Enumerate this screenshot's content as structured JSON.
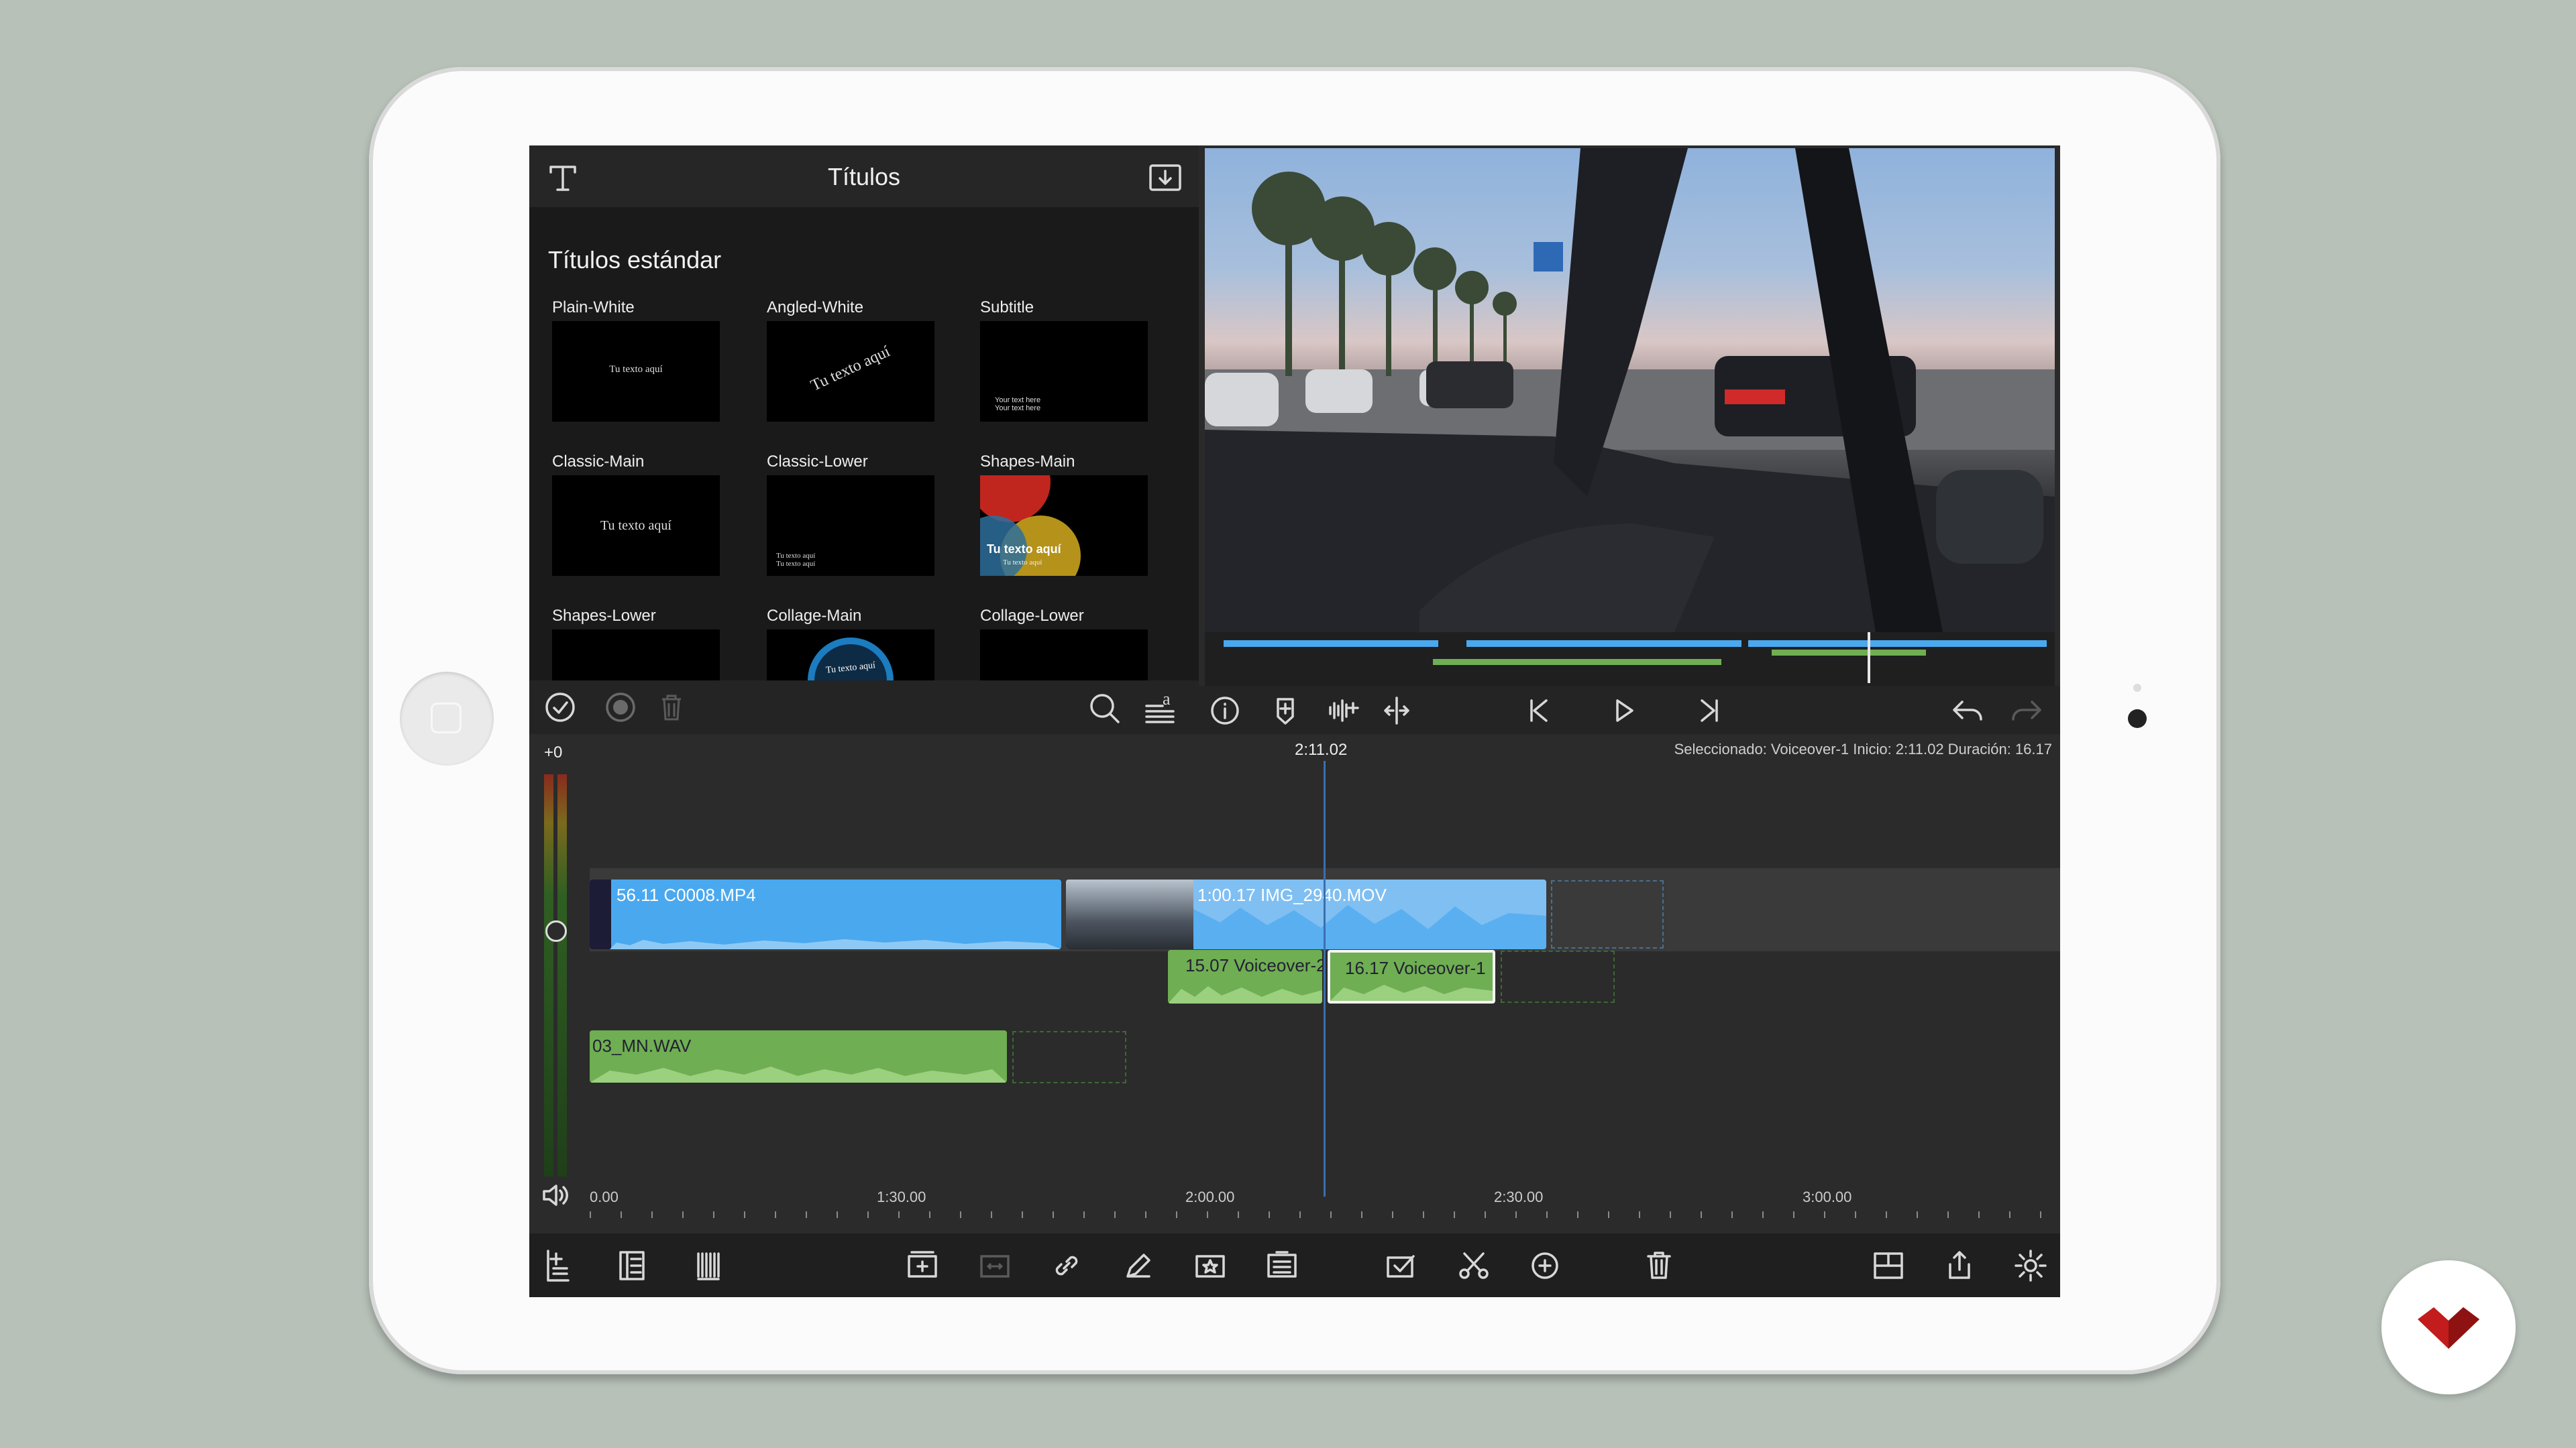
{
  "titles_panel": {
    "title": "Títulos",
    "section": "Títulos estándar",
    "templates": [
      {
        "name": "Plain-White",
        "sample": "Tu texto aquí"
      },
      {
        "name": "Angled-White",
        "sample": "Tu texto aquí"
      },
      {
        "name": "Subtitle",
        "sample": "Your text here\nYour text here"
      },
      {
        "name": "Classic-Main",
        "sample": "Tu texto aquí"
      },
      {
        "name": "Classic-Lower",
        "sample": "Tu texto aquí\nTu texto aquí"
      },
      {
        "name": "Shapes-Main",
        "sample": "Tu texto aquí"
      },
      {
        "name": "Shapes-Lower",
        "sample": ""
      },
      {
        "name": "Collage-Main",
        "sample": "Tu texto aquí"
      },
      {
        "name": "Collage-Lower",
        "sample": ""
      }
    ],
    "shapes_subtext": "Tu texto aquí"
  },
  "timeline": {
    "volume_label": "+0",
    "playhead_time": "2:11.02",
    "selection_info": "Seleccionado: Voiceover-1 Inicio: 2:11.02 Duración: 16.17",
    "clips": {
      "video1": "56.11  C0008.MP4",
      "video2": "1:00.17  IMG_2940.MOV",
      "voice1": "15.07  Voiceover-2",
      "voice2": "16.17  Voiceover-1",
      "music": "03_MN.WAV"
    },
    "ruler": [
      "0.00",
      "1:30.00",
      "2:00.00",
      "2:30.00",
      "3:00.00"
    ]
  },
  "colors": {
    "video_clip": "#4aa8ef",
    "audio_clip": "#6fae52",
    "background": "#b7c1b8"
  },
  "icons": [
    "text-icon",
    "import-icon",
    "check-icon",
    "record-icon",
    "trash-icon",
    "search-icon",
    "text-style-icon",
    "info-icon",
    "marker-icon",
    "add-keyframe-icon",
    "split-icon",
    "skip-back-icon",
    "play-icon",
    "skip-forward-icon",
    "undo-icon",
    "redo-icon",
    "speaker-icon"
  ]
}
